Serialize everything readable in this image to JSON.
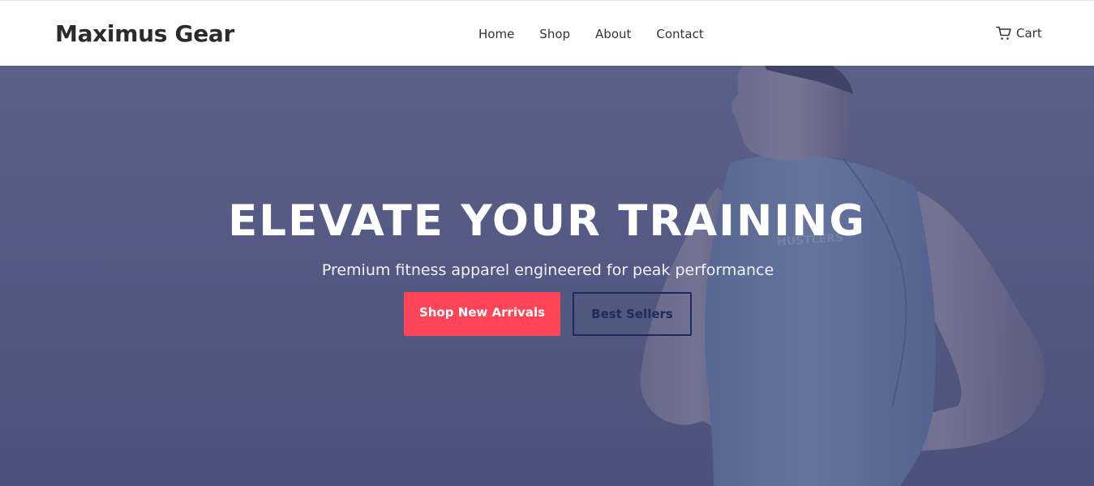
{
  "header": {
    "brand": "Maximus Gear",
    "nav": [
      "Home",
      "Shop",
      "About",
      "Contact"
    ],
    "cart_label": "Cart",
    "cart_icon": "shopping-cart-icon"
  },
  "hero": {
    "headline": "ELEVATE YOUR TRAINING",
    "subheadline": "Premium fitness apparel engineered for peak performance",
    "primary_cta": "Shop New Arrivals",
    "secondary_cta": "Best Sellers"
  },
  "colors": {
    "header_bg": "#ffffff",
    "hero_overlay": "#575d84",
    "primary_button": "#ff4458",
    "outline_button": "#1f2a5c",
    "text_dark": "#2b2b2b"
  }
}
